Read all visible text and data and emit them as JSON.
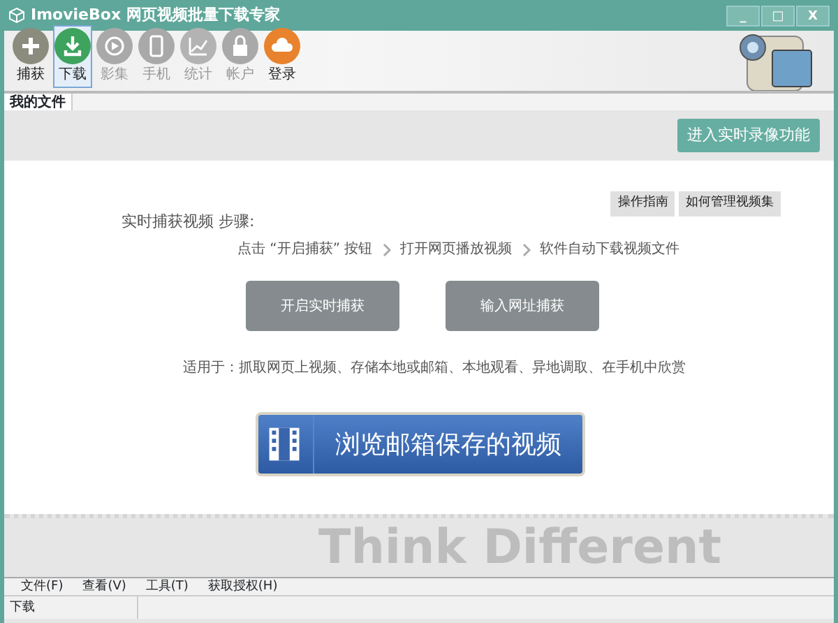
{
  "window": {
    "title": "ImovieBox 网页视频批量下载专家",
    "controls": [
      "_",
      "□",
      "X"
    ]
  },
  "toolbar": [
    {
      "label": "捕获",
      "kind": "plus",
      "color": "#8c8c7e",
      "disabled": false,
      "selected": false
    },
    {
      "label": "下载",
      "kind": "download",
      "color": "#3da35d",
      "disabled": false,
      "selected": true
    },
    {
      "label": "影集",
      "kind": "play",
      "color": "#a9a9a9",
      "disabled": true,
      "selected": false
    },
    {
      "label": "手机",
      "kind": "phone",
      "color": "#a9a9a9",
      "disabled": true,
      "selected": false
    },
    {
      "label": "统计",
      "kind": "chart",
      "color": "#b3b3b3",
      "disabled": true,
      "selected": false
    },
    {
      "label": "帐户",
      "kind": "lock",
      "color": "#a9a9a9",
      "disabled": true,
      "selected": false
    },
    {
      "label": "登录",
      "kind": "cloud",
      "color": "#e8822c",
      "disabled": false,
      "selected": false
    }
  ],
  "tabs": [
    {
      "label": "我的文件",
      "selected": true
    }
  ],
  "record_button": "进入实时录像功能",
  "help_buttons": [
    "操作指南",
    "如何管理视频集"
  ],
  "steps_title": "实时捕获视频 步骤:",
  "steps": [
    "点击 “开启捕获” 按钮",
    "打开网页播放视频",
    "软件自动下载视频文件"
  ],
  "action_buttons": [
    "开启实时捕获",
    "输入网址捕获"
  ],
  "usage": "适用于：抓取网页上视频、存储本地或邮箱、本地观看、异地调取、在手机中欣赏",
  "browse_button": "浏览邮箱保存的视频",
  "background_text": "Think Different",
  "menu": [
    "文件(F)",
    "查看(V)",
    "工具(T)",
    "获取授权(H)"
  ],
  "status_bar": "下载"
}
